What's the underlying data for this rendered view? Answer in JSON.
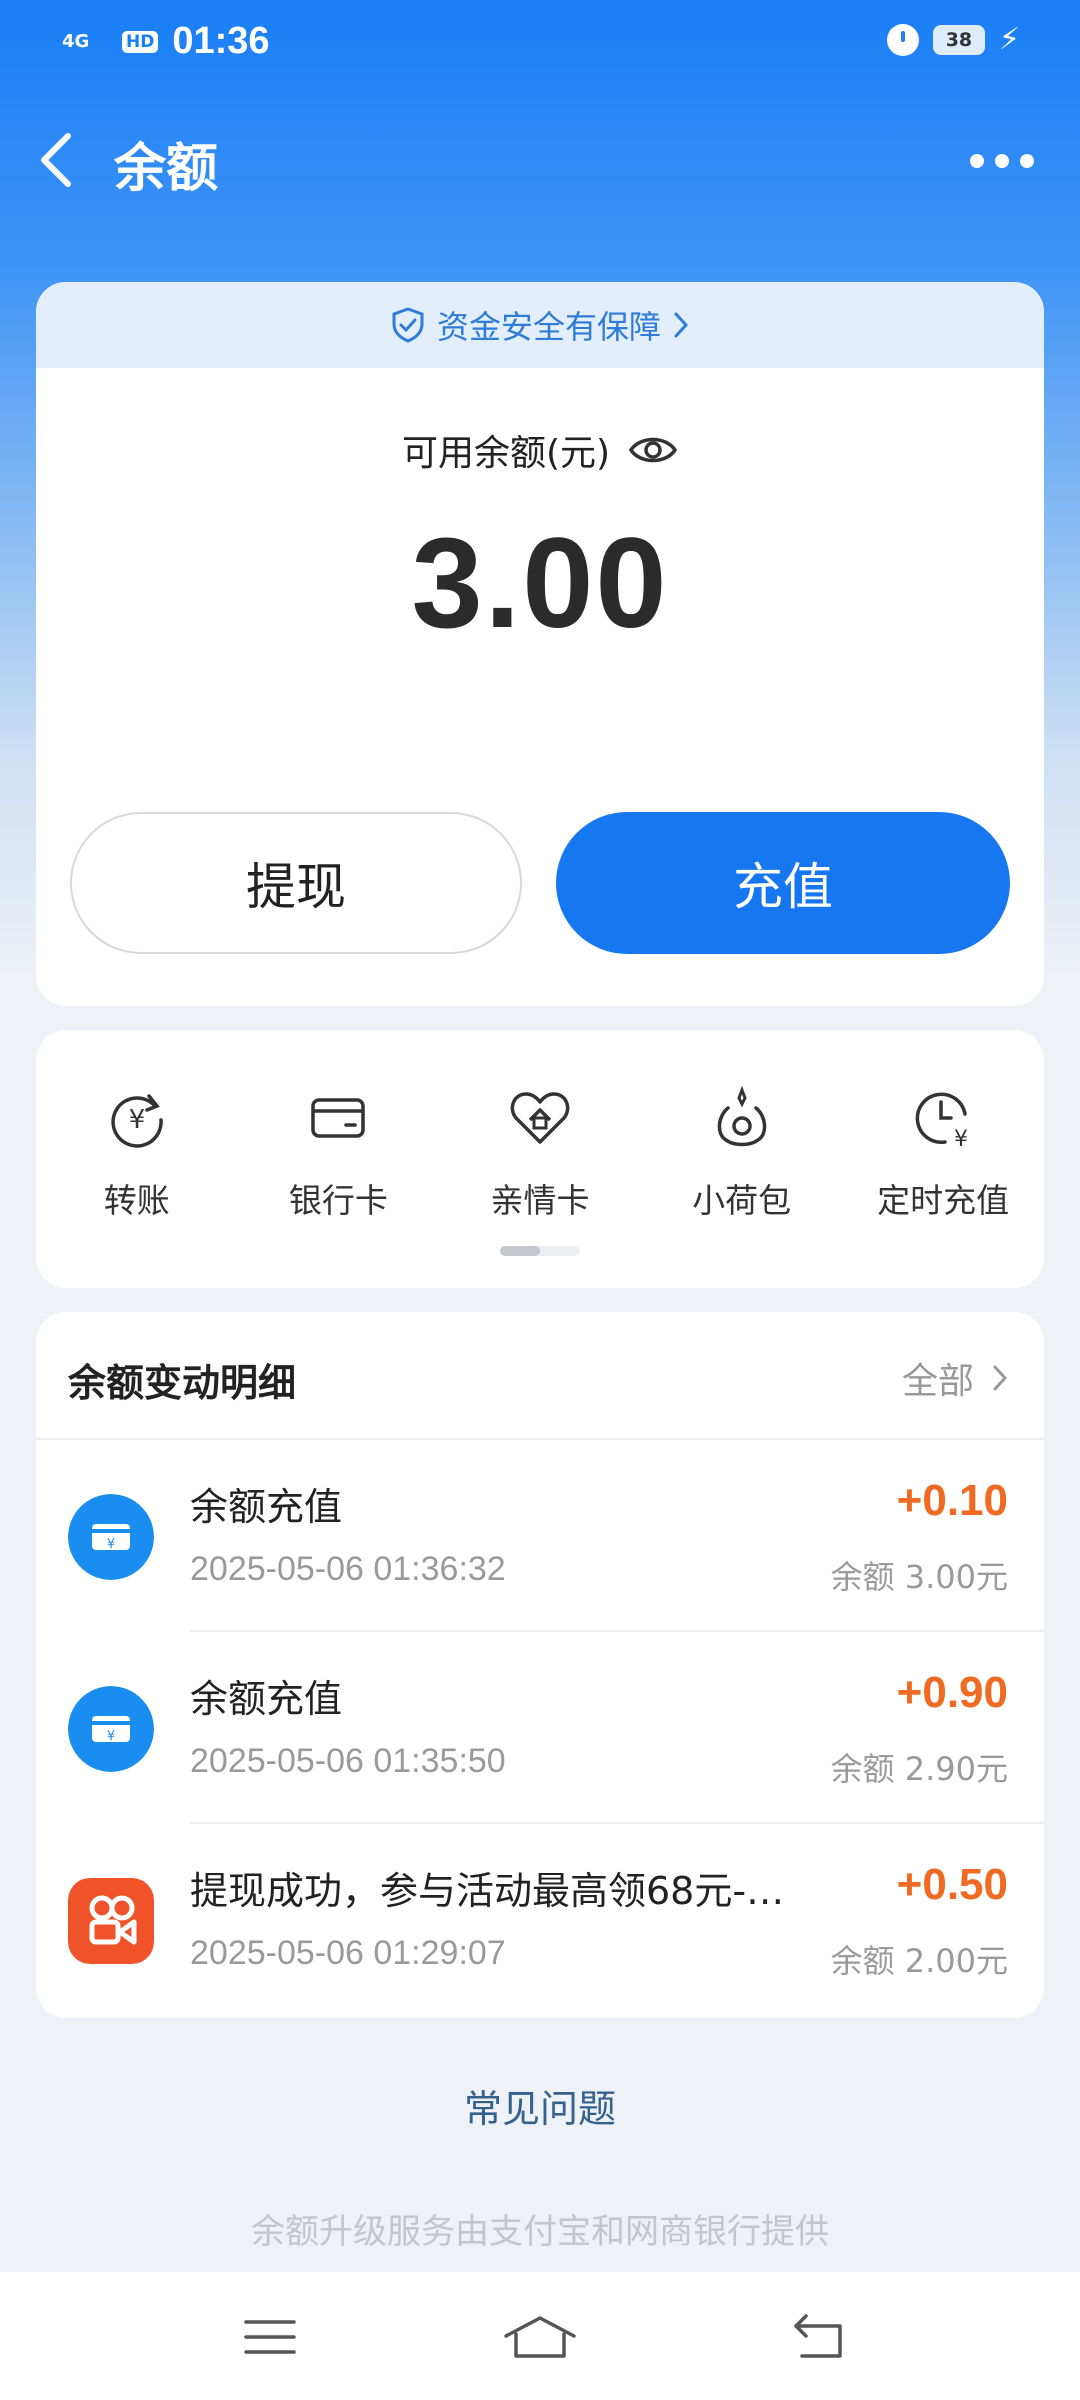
{
  "status_bar": {
    "network": "4G",
    "hd": "HD",
    "time": "01:36",
    "battery": "38"
  },
  "header": {
    "title": "余额"
  },
  "balance_card": {
    "security_note": "资金安全有保障",
    "label": "可用余额(元)",
    "amount": "3.00",
    "withdraw_label": "提现",
    "recharge_label": "充值"
  },
  "services": [
    {
      "label": "转账",
      "icon": "transfer-icon"
    },
    {
      "label": "银行卡",
      "icon": "bank-card-icon"
    },
    {
      "label": "亲情卡",
      "icon": "family-card-icon"
    },
    {
      "label": "小荷包",
      "icon": "small-purse-icon"
    },
    {
      "label": "定时充值",
      "icon": "scheduled-recharge-icon"
    }
  ],
  "records": {
    "title": "余额变动明细",
    "all_label": "全部",
    "items": [
      {
        "name": "余额充值",
        "time": "2025-05-06 01:36:32",
        "amount": "+0.10",
        "balance": "余额 3.00元",
        "icon": "recharge-card-icon"
      },
      {
        "name": "余额充值",
        "time": "2025-05-06 01:35:50",
        "amount": "+0.90",
        "balance": "余额 2.90元",
        "icon": "recharge-card-icon"
      },
      {
        "name": "提现成功，参与活动最高领68元-…",
        "time": "2025-05-06 01:29:07",
        "amount": "+0.50",
        "balance": "余额 2.00元",
        "icon": "video-app-icon"
      }
    ]
  },
  "faq_label": "常见问题",
  "footer_note": "余额升级服务由支付宝和网商银行提供",
  "colors": {
    "primary": "#1677f0",
    "amount_positive": "#f06a21"
  }
}
